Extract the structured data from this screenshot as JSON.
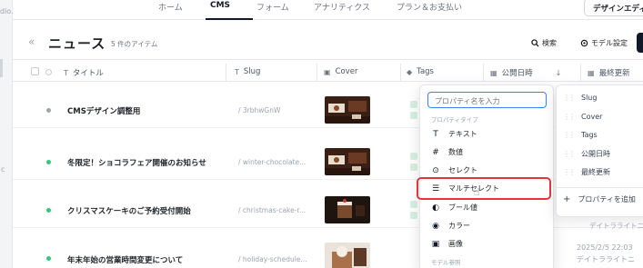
{
  "rail": {
    "fragment": "dio.site",
    "letter": "c"
  },
  "nav": {
    "tabs": [
      {
        "label": "ホーム",
        "active": false
      },
      {
        "label": "CMS",
        "active": true
      },
      {
        "label": "フォーム",
        "active": false
      },
      {
        "label": "アナリティクス",
        "active": false
      },
      {
        "label": "プラン＆お支払い",
        "active": false
      }
    ],
    "design_editor_label": "デザインエディタ"
  },
  "header": {
    "title": "ニュース",
    "count": "5 件のアイテム",
    "search_label": "検索",
    "model_settings_label": "モデル設定"
  },
  "table": {
    "columns": [
      {
        "icon": "T",
        "label": "タイトル"
      },
      {
        "icon": "T",
        "label": "Slug"
      },
      {
        "icon": "▣",
        "label": "Cover"
      },
      {
        "icon": "◆",
        "label": "Tags"
      },
      {
        "icon": "▦",
        "label": "公開日時"
      },
      {
        "icon": "▦",
        "label": "最終更新"
      }
    ],
    "rows": [
      {
        "status": "gray",
        "title": "CMSデザイン調整用",
        "slug": "/ 3rbhwGnW"
      },
      {
        "status": "green",
        "title": "冬限定！ショコラフェア開催のお知らせ",
        "slug": "/ winter-chocolate..."
      },
      {
        "status": "green",
        "title": "クリスマスケーキのご予約受付開始",
        "slug": "/ christmas-cake-r..."
      },
      {
        "status": "green",
        "title": "年末年始の営業時間変更について",
        "slug": "/ holiday-schedule..."
      }
    ],
    "row4_published": "2025/2/5 22:03",
    "row4_updated_by": "デイトラライトニ"
  },
  "dropdown": {
    "placeholder": "プロパティ名を入力",
    "section_type": "プロパティタイプ",
    "items": [
      {
        "icon": "T",
        "label": "テキスト"
      },
      {
        "icon": "#",
        "label": "数値"
      },
      {
        "icon": "⊙",
        "label": "セレクト"
      },
      {
        "icon": "☰",
        "label": "マルチセレクト"
      },
      {
        "icon": "◐",
        "label": "ブール値"
      },
      {
        "icon": "◉",
        "label": "カラー"
      },
      {
        "icon": "▣",
        "label": "画像"
      }
    ],
    "section_reference": "モデル参照"
  },
  "right_panel": {
    "items": [
      "Slug",
      "Cover",
      "Tags",
      "公開日時",
      "最終更新"
    ],
    "add_label": "プロパティを追加",
    "under_text_1": "デイトラライトニ"
  },
  "colors": {
    "accent": "#3b82f6",
    "highlight": "#e0373f",
    "status_green": "#34c77b"
  }
}
